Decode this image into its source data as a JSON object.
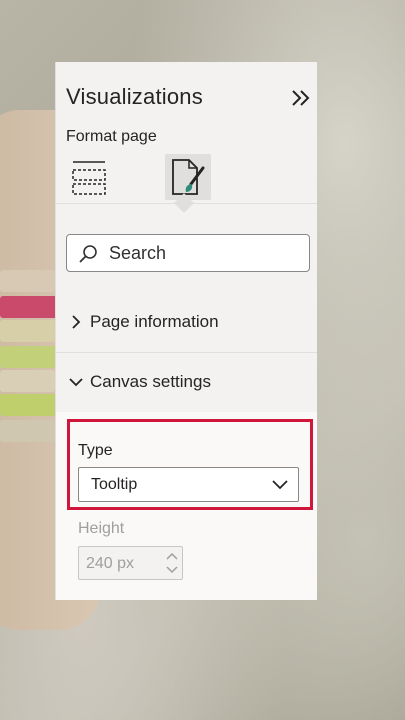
{
  "pane": {
    "title": "Visualizations",
    "subtitle": "Format page",
    "icons": {
      "collapse": "double-chevron-right-icon",
      "layout": "page-layout-icon",
      "format": "format-brush-icon"
    }
  },
  "search": {
    "placeholder": "Search",
    "icon": "search-icon"
  },
  "sections": [
    {
      "label": "Page information",
      "expanded": false
    },
    {
      "label": "Canvas settings",
      "expanded": true
    }
  ],
  "canvas_settings": {
    "type_label": "Type",
    "type_value": "Tooltip",
    "height_label": "Height",
    "height_value": "240 px"
  },
  "colors": {
    "highlight": "#d0163a",
    "pane_bg": "#f3f2f1",
    "accent_icon": "#2e8b7a"
  }
}
